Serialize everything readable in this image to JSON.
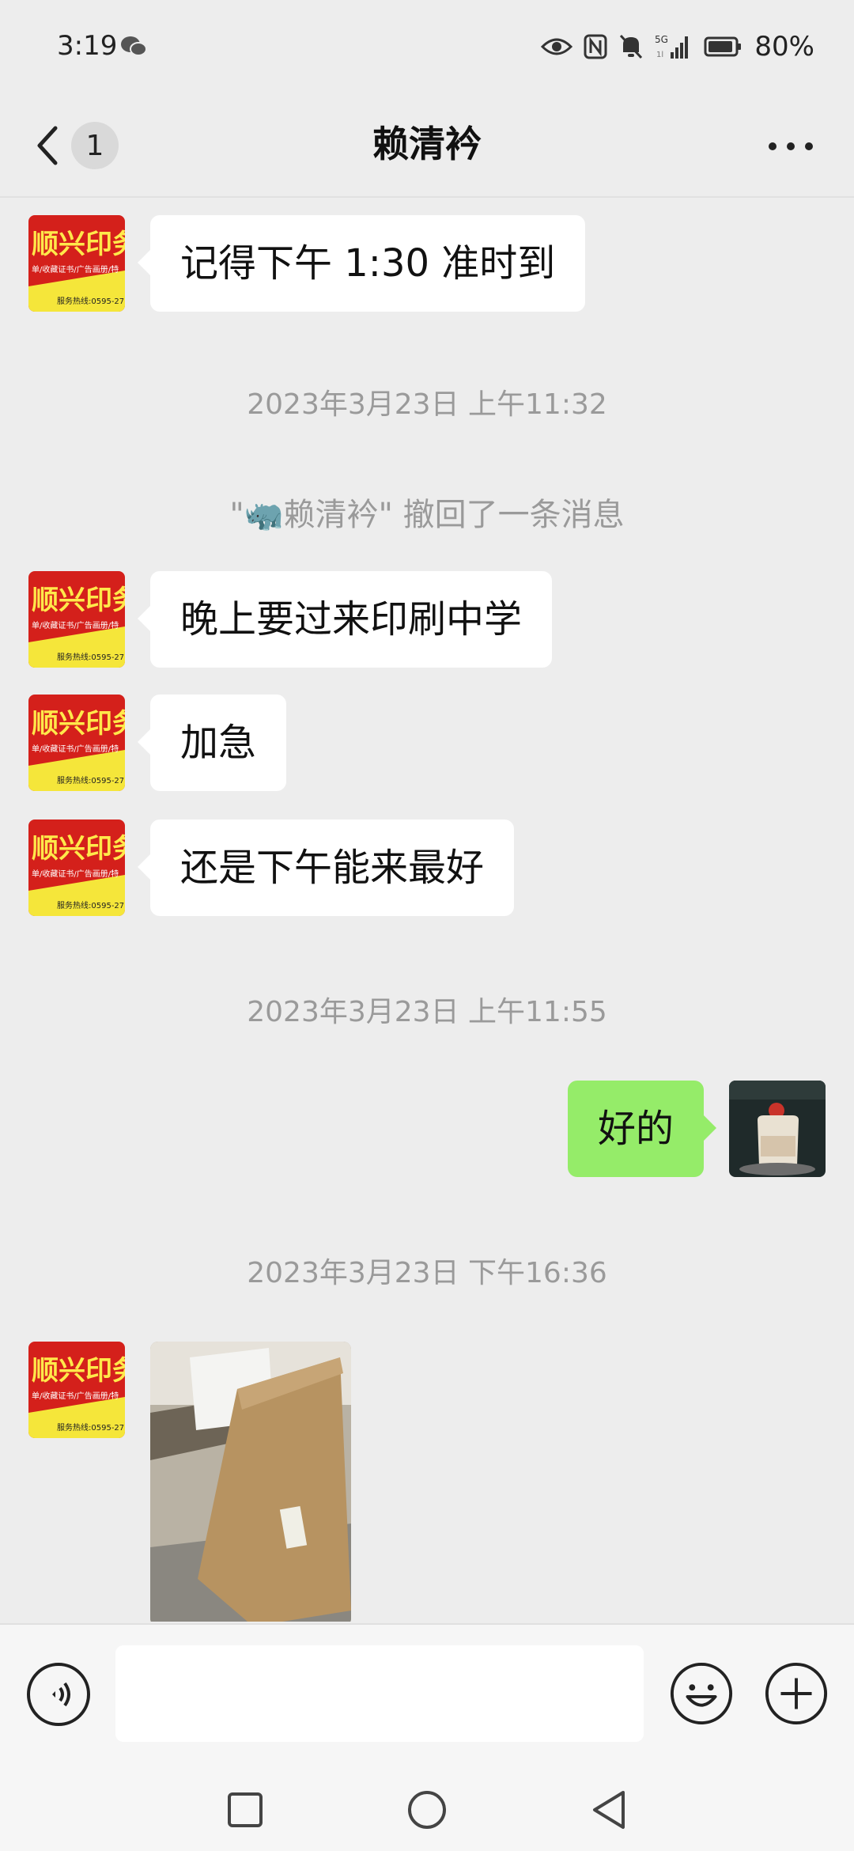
{
  "status_bar": {
    "time": "3:19",
    "battery": "80%",
    "network": "5G",
    "icons": [
      "wechat-icon",
      "eye-icon",
      "nfc-icon",
      "mute-bell-icon",
      "signal-icon",
      "battery-icon"
    ]
  },
  "header": {
    "back_badge": "1",
    "title": "赖清衿",
    "more_icon": "more-dots-icon"
  },
  "avatar_left": {
    "brand": "顺兴印务",
    "tagline": "单/收藏证书/广告画册/特",
    "hotline": "服务热线:0595-27"
  },
  "messages": [
    {
      "type": "text",
      "side": "left",
      "text": "记得下午 1:30 准时到"
    },
    {
      "type": "timestamp",
      "text": "2023年3月23日 上午11:32"
    },
    {
      "type": "recall",
      "text": "\"🦏赖清衿\" 撤回了一条消息"
    },
    {
      "type": "text",
      "side": "left",
      "text": "晚上要过来印刷中学"
    },
    {
      "type": "text",
      "side": "left",
      "text": "加急"
    },
    {
      "type": "text",
      "side": "left",
      "text": "还是下午能来最好"
    },
    {
      "type": "timestamp",
      "text": "2023年3月23日 上午11:55"
    },
    {
      "type": "text",
      "side": "right",
      "text": "好的"
    },
    {
      "type": "timestamp",
      "text": "2023年3月23日 下午16:36"
    },
    {
      "type": "image",
      "side": "left"
    }
  ],
  "input_bar": {
    "voice_icon": "voice-icon",
    "emoji_icon": "emoji-icon",
    "plus_icon": "plus-icon",
    "value": ""
  },
  "nav_bar": {
    "icons": [
      "recent-apps-icon",
      "home-icon",
      "back-triangle-icon"
    ]
  },
  "colors": {
    "background": "#ededed",
    "bubble_self": "#95ec69",
    "bubble_other": "#ffffff",
    "timestamp": "#9a9a9a"
  }
}
